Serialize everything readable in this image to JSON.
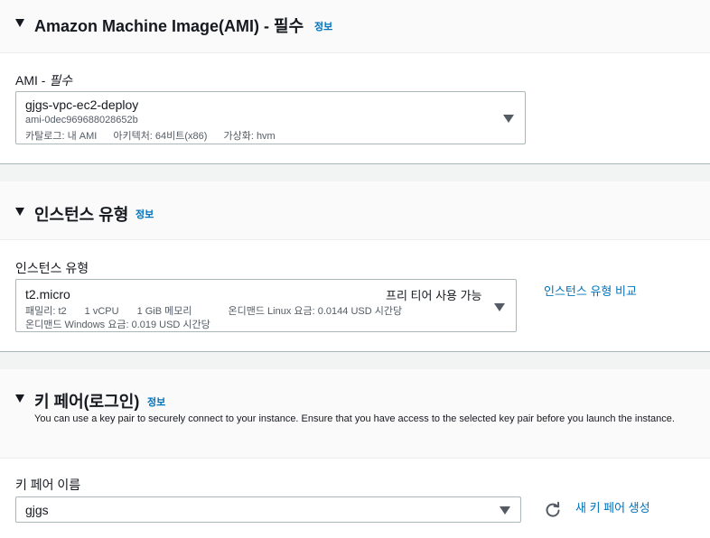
{
  "ami_section": {
    "title": "Amazon Machine Image(AMI) - 필수",
    "info": "정보",
    "field_label": "AMI - ",
    "field_label_required": "필수",
    "selected": {
      "name": "gjgs-vpc-ec2-deploy",
      "id": "ami-0dec969688028652b",
      "catalog": "카탈로그: 내 AMI",
      "architecture": "아키텍처: 64비트(x86)",
      "virtualization": "가상화: hvm"
    }
  },
  "instance_section": {
    "title": "인스턴스 유형",
    "info": "정보",
    "field_label": "인스턴스 유형",
    "selected": {
      "name": "t2.micro",
      "free_tier": "프리 티어 사용 가능",
      "family": "패밀리: t2",
      "vcpu": "1 vCPU",
      "memory": "1 GiB 메모리",
      "linux_price": "온디맨드 Linux 요금: 0.0144 USD 시간당",
      "windows_price": "온디맨드 Windows 요금: 0.019 USD 시간당"
    },
    "compare_link": "인스턴스 유형 비교"
  },
  "keypair_section": {
    "title": "키 페어(로그인)",
    "info": "정보",
    "description": "You can use a key pair to securely connect to your instance. Ensure that you have access to the selected key pair before you launch the instance.",
    "field_label": "키 페어 이름",
    "selected": "gjgs",
    "create_link": "새 키 페어 생성"
  },
  "colors": {
    "link": "#0073bb",
    "text": "#16191f",
    "muted": "#545b64",
    "border": "#aab7b8",
    "background": "#f2f3f3"
  }
}
